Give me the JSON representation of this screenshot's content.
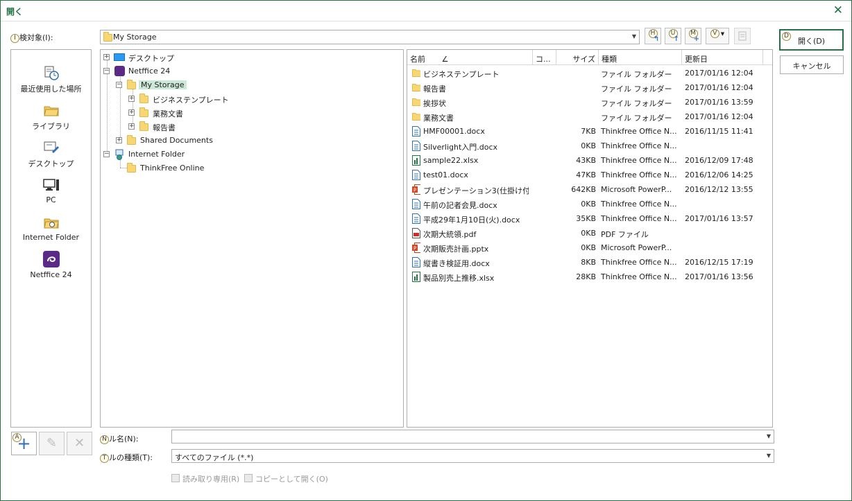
{
  "window": {
    "title": "開く"
  },
  "lookin": {
    "label": "検対象(I):",
    "value": "My Storage"
  },
  "toolbar": {
    "h": "H",
    "u": "U",
    "m": "M",
    "v": "V"
  },
  "buttons": {
    "open": "開く(D)",
    "cancel": "キャンセル",
    "open_key": "D"
  },
  "places": [
    {
      "label": "最近使用した場所",
      "icon": "recent-icon"
    },
    {
      "label": "ライブラリ",
      "icon": "library-icon"
    },
    {
      "label": "デスクトップ",
      "icon": "desktop-pen-icon"
    },
    {
      "label": "PC",
      "icon": "pc-icon"
    },
    {
      "label": "Internet Folder",
      "icon": "internet-folder-icon"
    },
    {
      "label": "Netffice 24",
      "icon": "netffice-icon"
    }
  ],
  "tree": [
    {
      "label": "デスクトップ"
    },
    {
      "label": "Netffice 24"
    },
    {
      "label": "My Storage"
    },
    {
      "label": "ビジネステンプレート"
    },
    {
      "label": "業務文書"
    },
    {
      "label": "報告書"
    },
    {
      "label": "Shared Documents"
    },
    {
      "label": "Internet Folder"
    },
    {
      "label": "ThinkFree Online"
    }
  ],
  "columns": {
    "name": "名前",
    "sort": "∠",
    "comment": "コ...",
    "size": "サイズ",
    "type": "種類",
    "modified": "更新日"
  },
  "files": [
    {
      "name": "ビジネステンプレート",
      "size": "",
      "type": "ファイル フォルダー",
      "modified": "2017/01/16 12:04",
      "icon": "folder"
    },
    {
      "name": "報告書",
      "size": "",
      "type": "ファイル フォルダー",
      "modified": "2017/01/16 12:04",
      "icon": "folder"
    },
    {
      "name": "挨拶状",
      "size": "",
      "type": "ファイル フォルダー",
      "modified": "2017/01/16 13:59",
      "icon": "folder"
    },
    {
      "name": "業務文書",
      "size": "",
      "type": "ファイル フォルダー",
      "modified": "2017/01/16 12:04",
      "icon": "folder"
    },
    {
      "name": "HMF00001.docx",
      "size": "7KB",
      "type": "Thinkfree Office N...",
      "modified": "2016/11/15 11:41",
      "icon": "doc"
    },
    {
      "name": "Silverlight入門.docx",
      "size": "0KB",
      "type": "Thinkfree Office N...",
      "modified": "",
      "icon": "doc"
    },
    {
      "name": "sample22.xlsx",
      "size": "43KB",
      "type": "Thinkfree Office N...",
      "modified": "2016/12/09 17:48",
      "icon": "xls"
    },
    {
      "name": "test01.docx",
      "size": "47KB",
      "type": "Thinkfree Office N...",
      "modified": "2016/12/06 14:25",
      "icon": "doc"
    },
    {
      "name": "プレゼンテーション3(仕掛け付)....",
      "size": "642KB",
      "type": "Microsoft PowerP...",
      "modified": "2016/12/12 13:55",
      "icon": "ppt"
    },
    {
      "name": "午前の記者会見.docx",
      "size": "0KB",
      "type": "Thinkfree Office N...",
      "modified": "",
      "icon": "doc"
    },
    {
      "name": "平成29年1月10日(火).docx",
      "size": "35KB",
      "type": "Thinkfree Office N...",
      "modified": "2017/01/16 13:57",
      "icon": "doc"
    },
    {
      "name": "次期大統領.pdf",
      "size": "0KB",
      "type": "PDF ファイル",
      "modified": "",
      "icon": "pdf"
    },
    {
      "name": "次期販売計画.pptx",
      "size": "0KB",
      "type": "Microsoft PowerP...",
      "modified": "",
      "icon": "ppt"
    },
    {
      "name": "縦書き検証用.docx",
      "size": "8KB",
      "type": "Thinkfree Office N...",
      "modified": "2016/12/15 17:19",
      "icon": "doc"
    },
    {
      "name": "製品別売上推移.xlsx",
      "size": "28KB",
      "type": "Thinkfree Office N...",
      "modified": "2017/01/16 13:56",
      "icon": "xls"
    }
  ],
  "filename": {
    "label": "ル名(N):",
    "key": "N",
    "value": ""
  },
  "filetype": {
    "label": "ルの種類(T):",
    "key": "T",
    "value": "すべてのファイル (*.*)"
  },
  "options": {
    "readonly": "読み取り専用(R)",
    "copy": "コピーとして開く(O)"
  },
  "lookin_key": "I",
  "add_key": "A",
  "colors": {
    "accent": "#217346",
    "selection": "#cce8d8"
  }
}
